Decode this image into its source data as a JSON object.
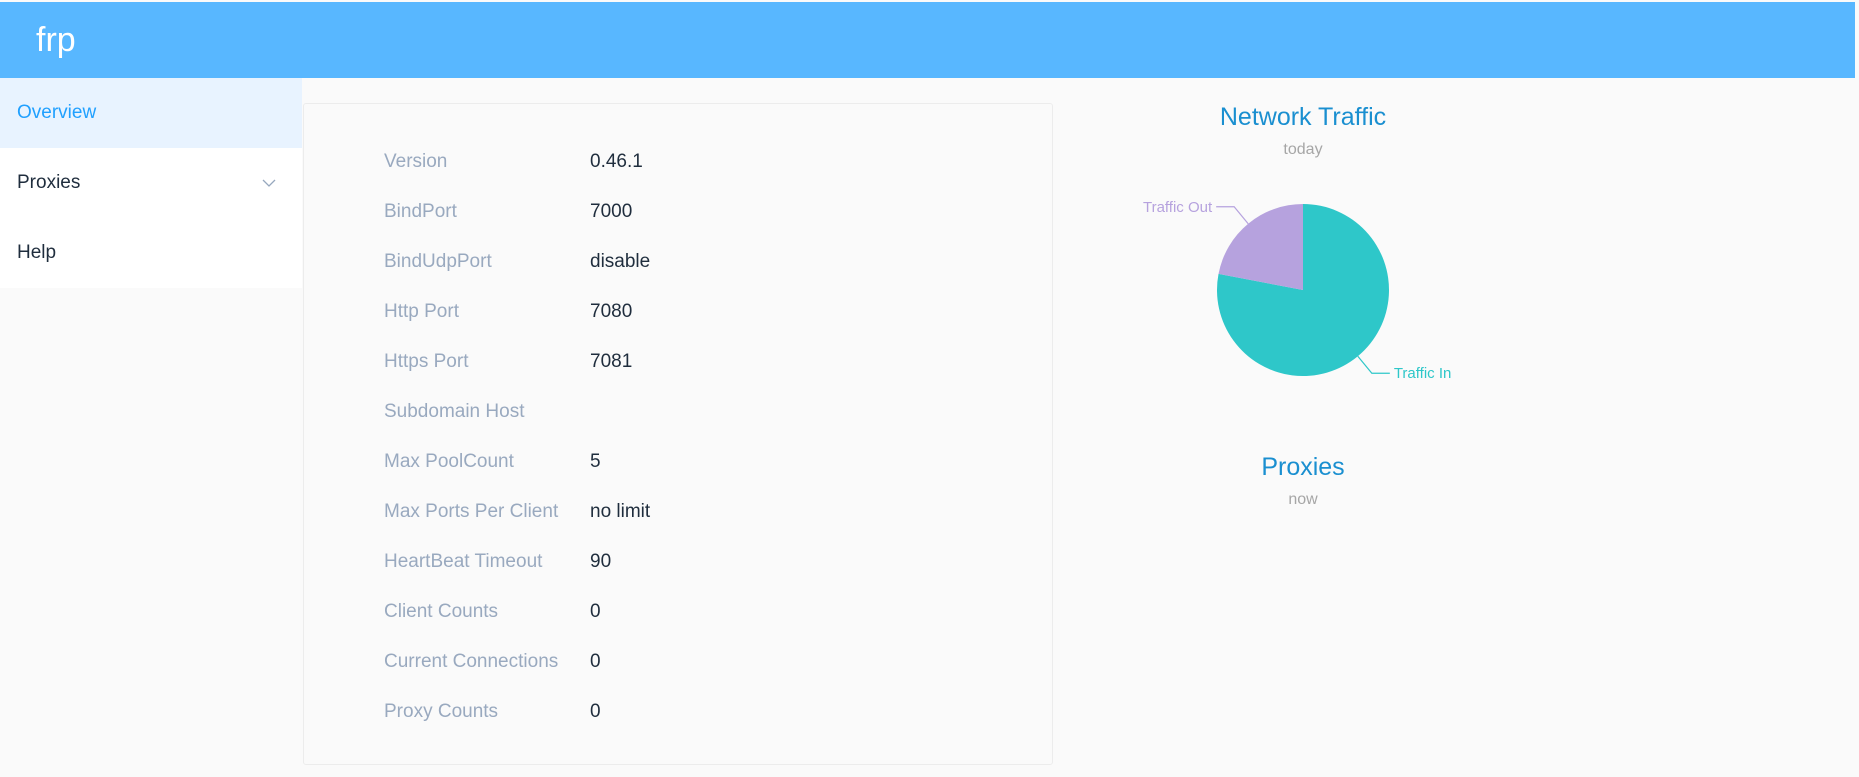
{
  "header": {
    "brand": "frp"
  },
  "sidebar": {
    "items": [
      {
        "label": "Overview",
        "active": true
      },
      {
        "label": "Proxies",
        "has_submenu": true,
        "icon": "chevron-down-icon"
      },
      {
        "label": "Help"
      }
    ]
  },
  "server_info": [
    {
      "label": "Version",
      "value": "0.46.1"
    },
    {
      "label": "BindPort",
      "value": "7000"
    },
    {
      "label": "BindUdpPort",
      "value": "disable"
    },
    {
      "label": "Http Port",
      "value": "7080"
    },
    {
      "label": "Https Port",
      "value": "7081"
    },
    {
      "label": "Subdomain Host",
      "value": ""
    },
    {
      "label": "Max PoolCount",
      "value": "5"
    },
    {
      "label": "Max Ports Per Client",
      "value": "no limit"
    },
    {
      "label": "HeartBeat Timeout",
      "value": "90"
    },
    {
      "label": "Client Counts",
      "value": "0"
    },
    {
      "label": "Current Connections",
      "value": "0"
    },
    {
      "label": "Proxy Counts",
      "value": "0"
    }
  ],
  "traffic_chart": {
    "title": "Network Traffic",
    "subtitle": "today"
  },
  "proxies_chart": {
    "title": "Proxies",
    "subtitle": "now"
  },
  "chart_data": {
    "type": "pie",
    "title": "Network Traffic",
    "subtitle": "today",
    "categories": [
      "Traffic In",
      "Traffic Out"
    ],
    "values": [
      78,
      22
    ],
    "colors": [
      "#2ec7c9",
      "#b6a2de"
    ],
    "start_angle_deg": 90
  },
  "colors": {
    "header": "#58b7ff",
    "active_menu_bg": "#e8f3ff",
    "active_menu_text": "#20a0ff",
    "label": "#99a9bf",
    "chart_title": "#1a8fd0"
  }
}
